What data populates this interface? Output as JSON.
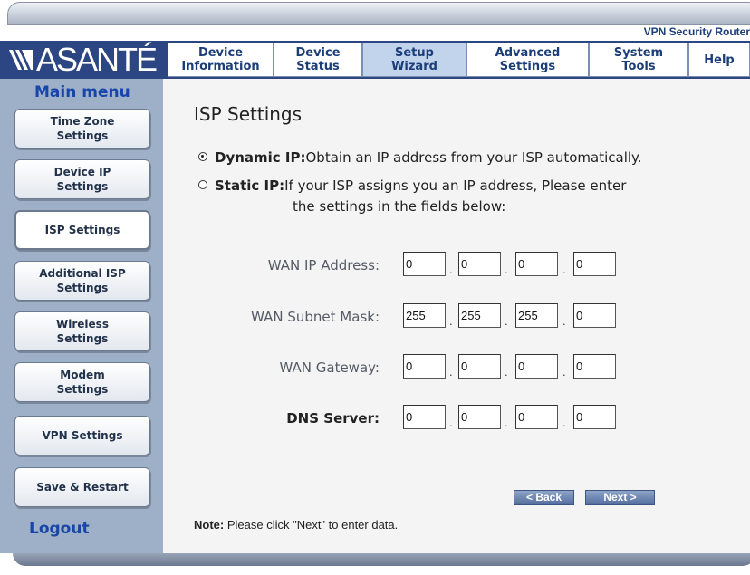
{
  "app": {
    "product_title": "VPN Security Router",
    "logo_text": "ASANTÉ"
  },
  "top_nav": {
    "tabs": [
      {
        "label": "Device\nInformation",
        "active": false
      },
      {
        "label": "Device\nStatus",
        "active": false
      },
      {
        "label": "Setup\nWizard",
        "active": true
      },
      {
        "label": "Advanced\nSettings",
        "active": false
      },
      {
        "label": "System\nTools",
        "active": false
      },
      {
        "label": "Help",
        "active": false
      }
    ]
  },
  "sidebar": {
    "title": "Main menu",
    "items": [
      {
        "label": "Time Zone\nSettings",
        "active": false
      },
      {
        "label": "Device IP\nSettings",
        "active": false
      },
      {
        "label": "ISP Settings",
        "active": true
      },
      {
        "label": "Additional ISP\nSettings",
        "active": false
      },
      {
        "label": "Wireless\nSettings",
        "active": false
      },
      {
        "label": "Modem\nSettings",
        "active": false
      },
      {
        "label": "VPN Settings",
        "active": false
      },
      {
        "label": "Save & Restart",
        "active": false
      }
    ],
    "logout_label": "Logout"
  },
  "main": {
    "title": "ISP Settings",
    "options": [
      {
        "name": "Dynamic IP:",
        "description": "Obtain an IP address from your ISP automatically.",
        "selected": true
      },
      {
        "name": "Static IP:",
        "description": "If your ISP assigns you an IP address, Please enter",
        "description_line2": "the settings in the fields below:",
        "selected": false
      }
    ],
    "fields": [
      {
        "label": "WAN IP Address:",
        "octets": [
          "0",
          "0",
          "0",
          "0"
        ]
      },
      {
        "label": "WAN Subnet Mask:",
        "octets": [
          "255",
          "255",
          "255",
          "0"
        ]
      },
      {
        "label": "WAN Gateway:",
        "octets": [
          "0",
          "0",
          "0",
          "0"
        ]
      },
      {
        "label": "DNS Server:",
        "octets": [
          "0",
          "0",
          "0",
          "0"
        ]
      }
    ],
    "back_label": "< Back",
    "next_label": "Next >",
    "note_label": "Note:",
    "note_text": " Please click \"Next\" to enter data."
  },
  "colors": {
    "header_bg": "#2c4683",
    "sidebar_bg": "#9eb0c8",
    "content_bg": "#f4f4f4",
    "accent_blue": "#1746a8"
  }
}
